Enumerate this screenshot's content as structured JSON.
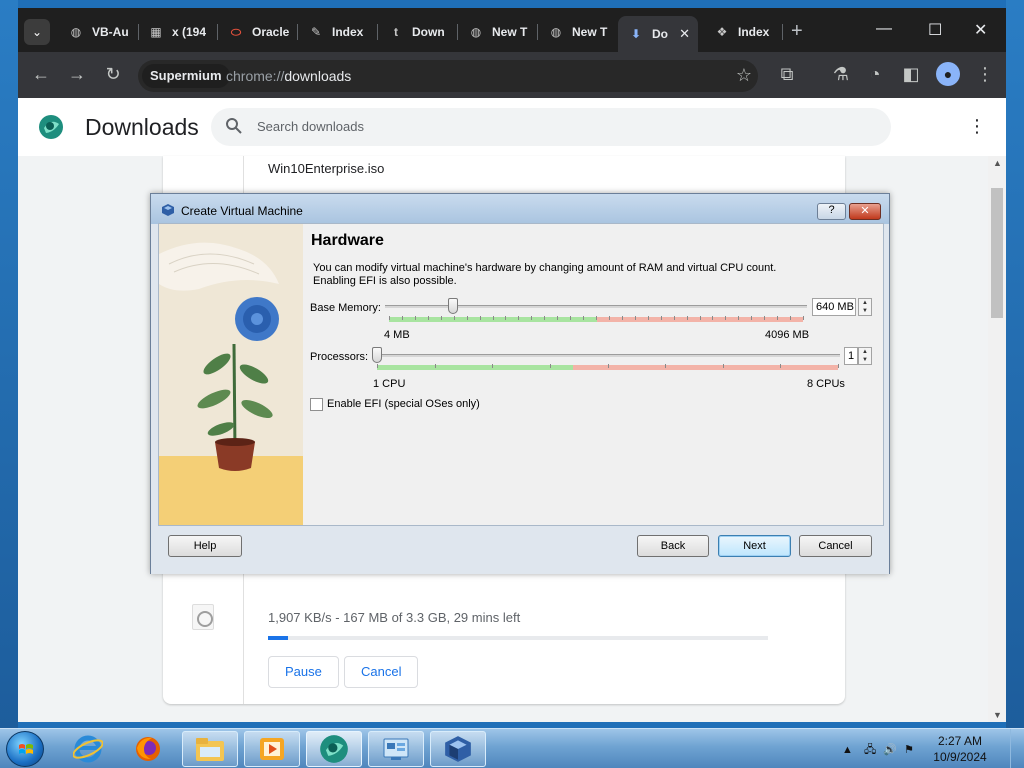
{
  "browser": {
    "tabs": [
      {
        "label": "VB-Au",
        "icon": "globe-icon"
      },
      {
        "label": "x (194",
        "icon": "x-icon"
      },
      {
        "label": "Oracle",
        "icon": "oracle-icon"
      },
      {
        "label": "Index",
        "icon": "index-icon"
      },
      {
        "label": "Down",
        "icon": "tumblr-icon"
      },
      {
        "label": "New T",
        "icon": "globe-icon"
      },
      {
        "label": "New T",
        "icon": "globe-icon"
      },
      {
        "label": "Do",
        "icon": "download-icon"
      },
      {
        "label": "Index",
        "icon": "index-icon"
      }
    ],
    "profile_chip": "Supermium",
    "url_scheme": "chrome://",
    "url_path": "downloads"
  },
  "downloads": {
    "title": "Downloads",
    "search_placeholder": "Search downloads",
    "filename": "Win10Enterprise.iso",
    "status": "1,907 KB/s - 167 MB of 3.3 GB, 29 mins left",
    "progress": 0.04,
    "pause_label": "Pause",
    "cancel_label": "Cancel"
  },
  "dialog": {
    "title": "Create Virtual Machine",
    "help_btn": "?",
    "close_btn": "✕",
    "heading": "Hardware",
    "description_line1": "You can modify virtual machine's hardware by changing amount of RAM and virtual CPU count.",
    "description_line2": "Enabling EFI is also possible.",
    "memory": {
      "label": "Base Memory:",
      "min_label": "4 MB",
      "max_label": "4096 MB",
      "value_text": "640 MB",
      "value": 640,
      "min": 4,
      "max": 4096
    },
    "processors": {
      "label": "Processors:",
      "min_label": "1 CPU",
      "max_label": "8 CPUs",
      "value_text": "1",
      "value": 1,
      "min": 1,
      "max": 8
    },
    "efi_label": "Enable EFI (special OSes only)",
    "efi_checked": false,
    "buttons": {
      "help": "Help",
      "back": "Back",
      "next": "Next",
      "cancel": "Cancel"
    }
  },
  "taskbar": {
    "time": "2:27 AM",
    "date": "10/9/2024"
  },
  "colors": {
    "accent": "#1a73e8",
    "green_band": "#a8e4a0",
    "red_band": "#f3b3a8"
  }
}
